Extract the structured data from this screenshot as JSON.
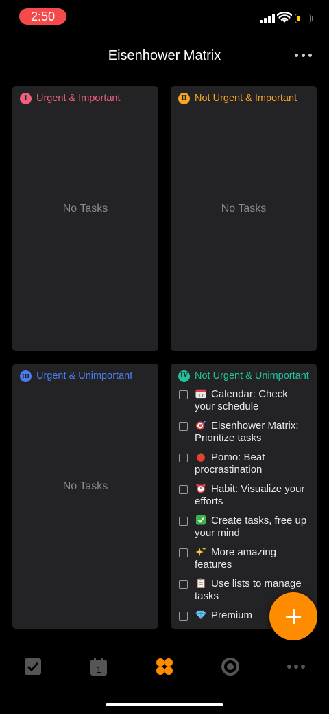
{
  "status_bar": {
    "time": "2:50"
  },
  "header": {
    "title": "Eisenhower Matrix"
  },
  "colors": {
    "q1": "#f0607e",
    "q2": "#f5a623",
    "q3": "#4a7ef0",
    "q4": "#21c19a",
    "accent": "#ff8c00",
    "tab_inactive": "#555555"
  },
  "quadrants": [
    {
      "numeral": "I",
      "title": "Urgent & Important",
      "empty_text": "No Tasks"
    },
    {
      "numeral": "II",
      "title": "Not Urgent & Important",
      "empty_text": "No Tasks"
    },
    {
      "numeral": "III",
      "title": "Urgent & Unimportant",
      "empty_text": "No Tasks"
    },
    {
      "numeral": "IV",
      "title": "Not Urgent & Unimportant",
      "tasks": [
        {
          "icon": "calendar-icon",
          "text": "Calendar: Check your schedule"
        },
        {
          "icon": "dart-icon",
          "text": "Eisenhower Matrix: Prioritize tasks"
        },
        {
          "icon": "tomato-icon",
          "text": "Pomo: Beat procrastination"
        },
        {
          "icon": "alarm-clock-icon",
          "text": "Habit: Visualize your efforts"
        },
        {
          "icon": "check-mark-icon",
          "text": "Create tasks, free up your mind"
        },
        {
          "icon": "sparkles-icon",
          "text": "More amazing features"
        },
        {
          "icon": "clipboard-icon",
          "text": "Use lists to manage tasks"
        },
        {
          "icon": "gem-icon",
          "text": "Premium"
        }
      ]
    }
  ],
  "tab_bar": {
    "items": [
      {
        "icon": "checkbox-icon",
        "active": false
      },
      {
        "icon": "calendar-icon",
        "label": "1",
        "active": false
      },
      {
        "icon": "matrix-icon",
        "active": true
      },
      {
        "icon": "pomodoro-icon",
        "active": false
      },
      {
        "icon": "more-icon",
        "active": false
      }
    ]
  }
}
